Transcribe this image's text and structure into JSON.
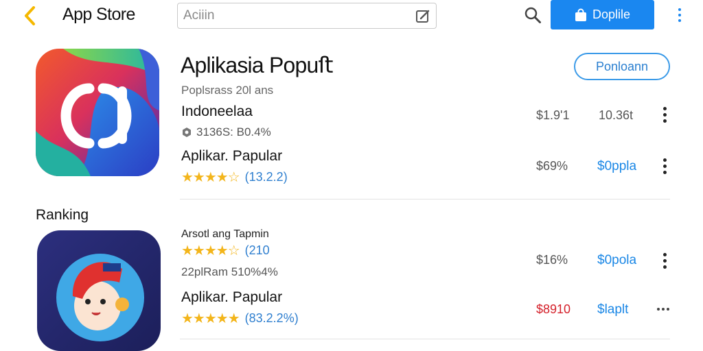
{
  "header": {
    "title": "App Store",
    "search_value": "Aciiin",
    "primary_button": "Doplile"
  },
  "featured": {
    "title": "Aplikasia Popuﬅ",
    "button_label": "Ponloann",
    "subtitle": "Poplsrass 20l ans",
    "name": "Indoneelaa",
    "meta": "3136S: B0.4%",
    "secondary_name": "Aplikar. Papular",
    "rating_stars": 4.5,
    "rating_count": "(13.2.2)",
    "price_1": "$1.9'1",
    "action_1": "10.36t",
    "price_2": "$69%",
    "action_2": "$0ppla"
  },
  "ranking": {
    "label": "Ranking",
    "item1": {
      "title": "Arsotl ang Tapmin",
      "rating_stars": 4.5,
      "rating_count": "(210",
      "meta": "22plRam 510%4%",
      "price": "$16%",
      "action": "$0pola"
    },
    "item2": {
      "title": "Aplikar. Papular",
      "rating_stars": 5,
      "rating_count": "(83.2.2%)",
      "price": "$8910",
      "action": "$laplt"
    }
  },
  "colors": {
    "accent": "#1a87f0",
    "star": "#f3b51b",
    "link": "#1a87e6",
    "price_red": "#d4202a",
    "back_arrow": "#f5b800"
  },
  "icons": [
    "back-arrow-icon",
    "edit-icon",
    "search-icon",
    "shopping-bag-icon",
    "more-vertical-icon",
    "more-horizontal-icon",
    "star-icon"
  ]
}
